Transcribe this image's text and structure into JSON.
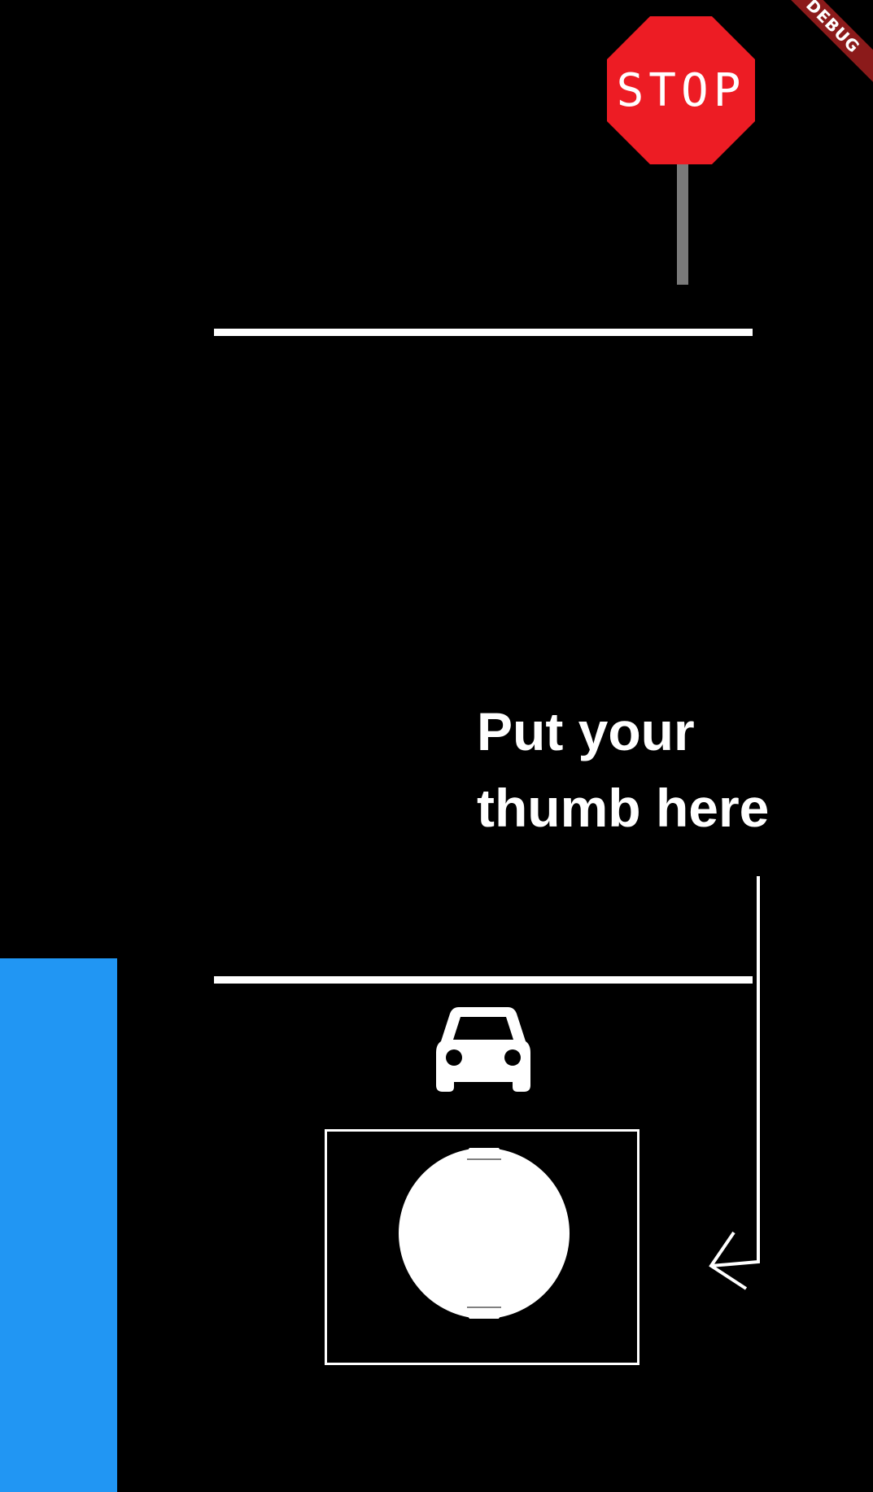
{
  "stop_sign": {
    "text": "STOP",
    "color": "#ed1c24",
    "pole_color": "#7a7a7a"
  },
  "instruction": {
    "line1": "Put your",
    "line2": "thumb here"
  },
  "debug_banner": {
    "label": "DEBUG"
  },
  "colors": {
    "background": "#000000",
    "road_line": "#ffffff",
    "blue_bar": "#2196f3"
  },
  "icons": {
    "car": "car-icon",
    "arrow": "arrow-pointing-left-icon",
    "thumb": "thumb-circle-icon"
  }
}
